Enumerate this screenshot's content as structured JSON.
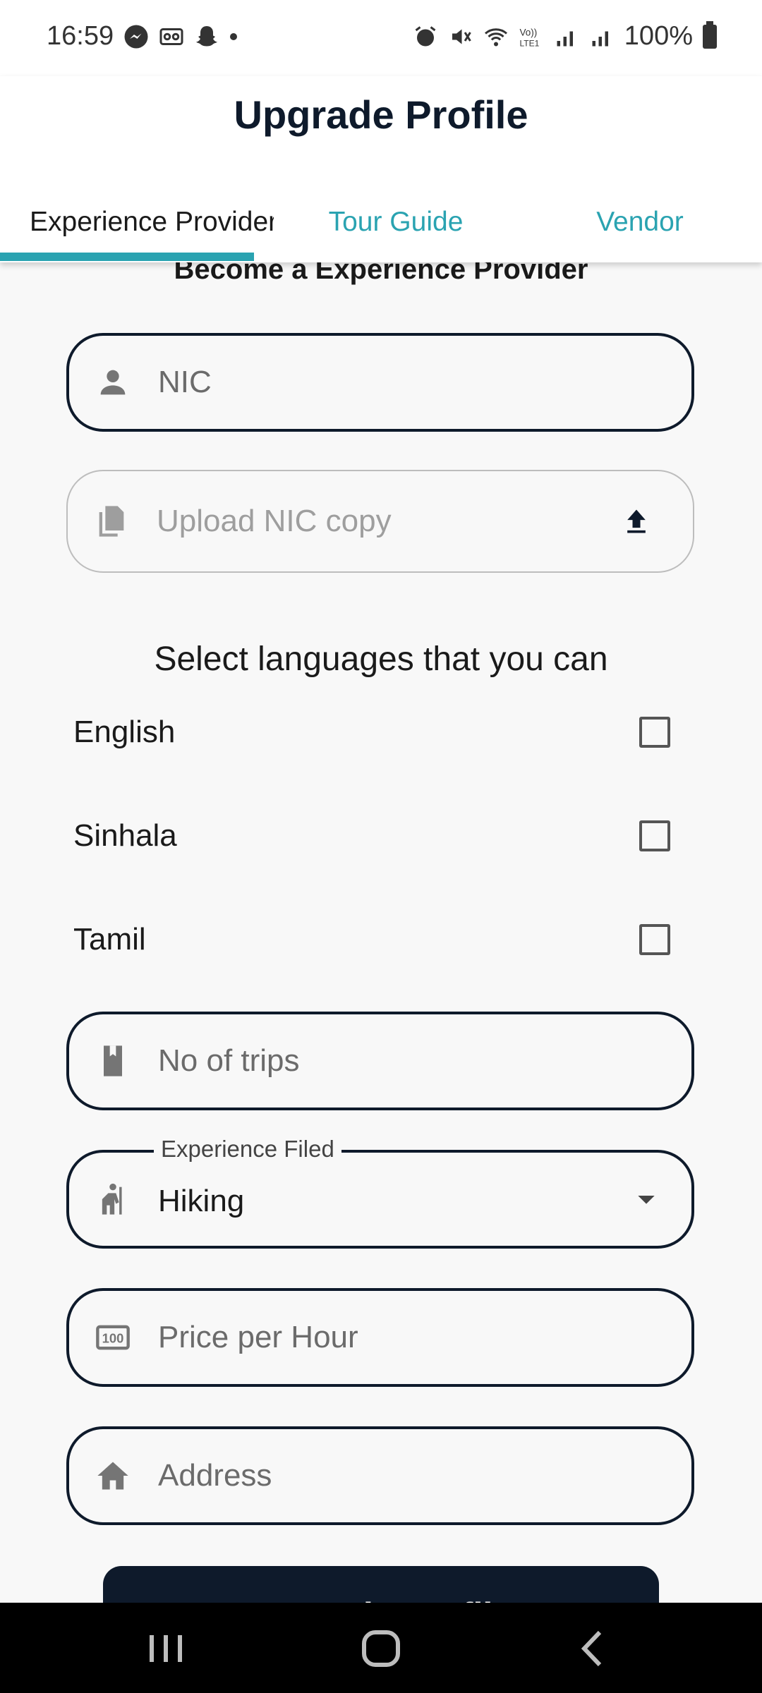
{
  "status_bar": {
    "time": "16:59",
    "battery": "100%"
  },
  "app_bar": {
    "title": "Upgrade Profile"
  },
  "tabs": [
    {
      "label": "Experience Provider",
      "active": true
    },
    {
      "label": "Tour Guide",
      "active": false
    },
    {
      "label": "Vendor",
      "active": false
    }
  ],
  "form": {
    "section_title": "Become a Experience Provider",
    "nic_placeholder": "NIC",
    "upload_placeholder": "Upload NIC copy",
    "languages_title": "Select languages that you can",
    "languages": [
      {
        "label": "English",
        "checked": false
      },
      {
        "label": "Sinhala",
        "checked": false
      },
      {
        "label": "Tamil",
        "checked": false
      }
    ],
    "trips_placeholder": "No of trips",
    "experience_label": "Experience Filed",
    "experience_value": "Hiking",
    "price_placeholder": "Price per Hour",
    "address_placeholder": "Address",
    "submit_label": "Upgrade Profile"
  },
  "colors": {
    "accent": "#2aa3b1",
    "primary": "#0e1a2b",
    "background": "#f8f8f8"
  }
}
